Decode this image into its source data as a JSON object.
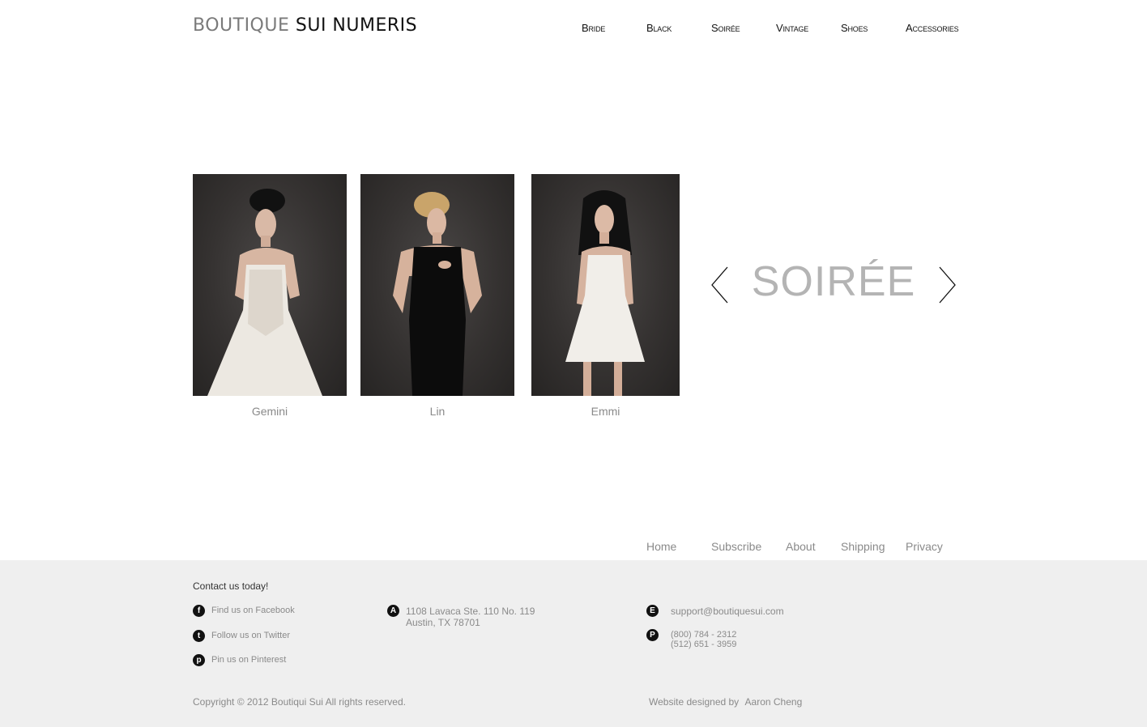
{
  "brand": {
    "part1": "BOUTIQUE",
    "part2": "SUI NUMERIS"
  },
  "nav": [
    "Bride",
    "Black",
    "Soirée",
    "Vintage",
    "Shoes",
    "Accessories"
  ],
  "gallery": {
    "collection_title": "SOIRÉE",
    "items": [
      {
        "caption": "Gemini",
        "dress": "white-gown"
      },
      {
        "caption": "Lin",
        "dress": "black-dress"
      },
      {
        "caption": "Emmi",
        "dress": "white-short-dress"
      }
    ],
    "prev_icon": "chevron-left-icon",
    "next_icon": "chevron-right-icon"
  },
  "footer_nav": [
    "Home",
    "Subscribe",
    "About",
    "Shipping",
    "Privacy"
  ],
  "contact": {
    "title": "Contact us today!",
    "social": [
      {
        "icon": "facebook-icon",
        "glyph": "f",
        "label": "Find us on Facebook"
      },
      {
        "icon": "twitter-icon",
        "glyph": "t",
        "label": "Follow us on Twitter"
      },
      {
        "icon": "pinterest-icon",
        "glyph": "p",
        "label": "Pin us on Pinterest"
      }
    ],
    "address": {
      "icon": "address-icon",
      "glyph": "A",
      "line1": "1108 Lavaca Ste. 110 No. 119",
      "line2": "Austin, TX 78701"
    },
    "email": {
      "icon": "email-icon",
      "glyph": "E",
      "value": "support@boutiquesui.com"
    },
    "phone": {
      "icon": "phone-icon",
      "glyph": "P",
      "line1": "(800) 784 - 2312",
      "line2": "(512) 651 - 3959"
    }
  },
  "copyright": "Copyright © 2012 Boutiqui Sui All rights reserved.",
  "designer": {
    "label": "Website designed by",
    "name": "Aaron Cheng"
  },
  "colors": {
    "footer_bg": "#efefef",
    "muted_text": "#8a8a8a",
    "title_gray": "#b4b4b4"
  }
}
